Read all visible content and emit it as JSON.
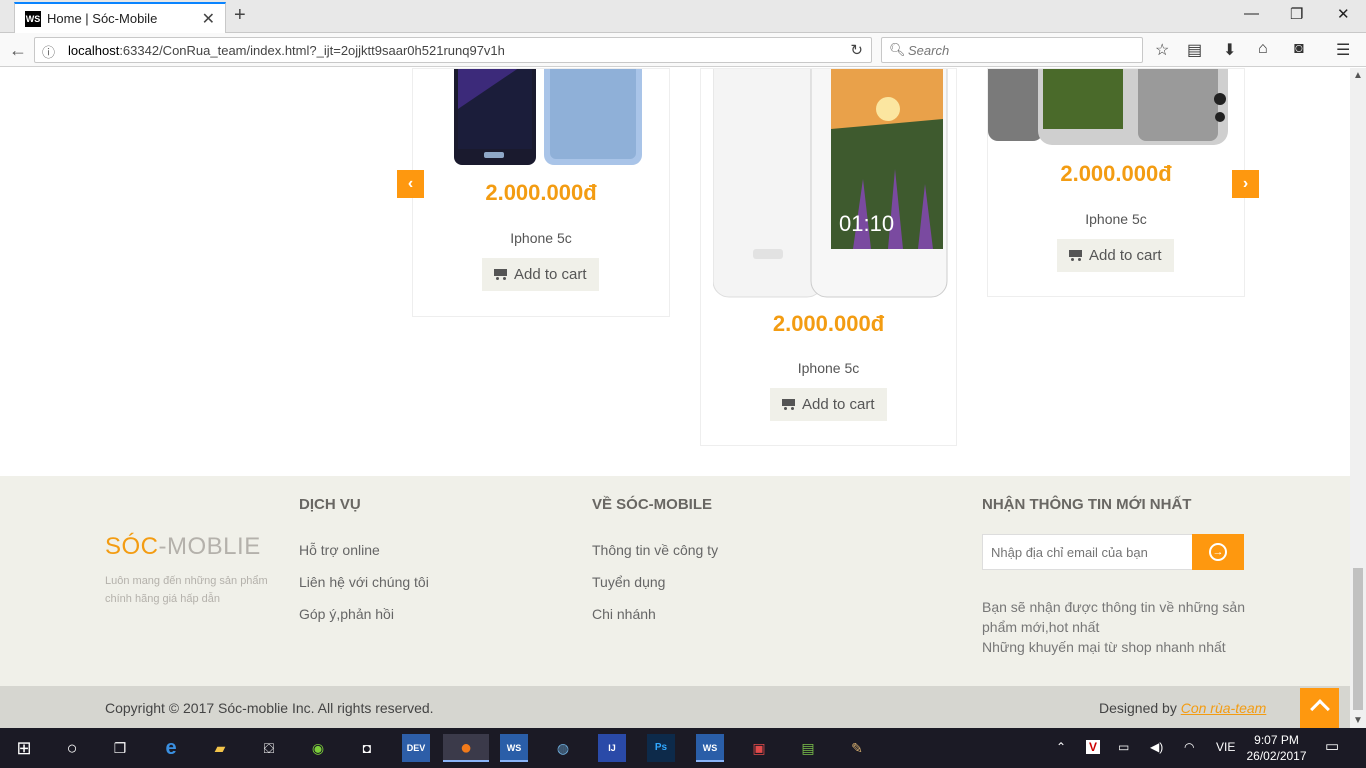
{
  "browser": {
    "tab_title": "Home | Sóc-Mobile",
    "tab_favicon": "WS",
    "url_host": "localhost",
    "url_rest": ":63342/ConRua_team/index.html?_ijt=2ojjktt9saar0h521runq97v1h",
    "search_placeholder": "Search"
  },
  "products": [
    {
      "price": "2.000.000đ",
      "name": "Iphone 5c",
      "cart_label": "Add to cart"
    },
    {
      "price": "2.000.000đ",
      "name": "Iphone 5c",
      "cart_label": "Add to cart"
    },
    {
      "price": "2.000.000đ",
      "name": "Iphone 5c",
      "cart_label": "Add to cart"
    }
  ],
  "carousel": {
    "prev_icon": "chevron-left-icon",
    "next_icon": "chevron-right-icon"
  },
  "footer": {
    "brand_main": "SÓC",
    "brand_rest": "-MOBLIE",
    "slogan": "Luôn mang đến những sản phẩm chính hãng giá hấp dẫn",
    "services": {
      "heading": "DỊCH VỤ",
      "links": [
        "Hỗ trợ online",
        "Liên hệ với chúng tôi",
        "Góp ý,phản hồi"
      ]
    },
    "about": {
      "heading": "VỀ SÓC-MOBILE",
      "links": [
        "Thông tin về công ty",
        "Tuyển dụng",
        "Chi nhánh"
      ]
    },
    "newsletter": {
      "heading": "NHẬN THÔNG TIN MỚI NHẤT",
      "placeholder": "Nhập địa chỉ email của bạn",
      "info_line1": "Bạn sẽ nhận được thông tin về những sản phẩm mới,hot nhất",
      "info_line2": "Những khuyến mại từ shop nhanh nhất"
    },
    "copyright": "Copyright © 2017 Sóc-moblie Inc. All rights reserved.",
    "designed_by": "Designed by ",
    "designer": "Con rùa-team"
  },
  "taskbar": {
    "lang": "VIE",
    "time": "9:07 PM",
    "date": "26/02/2017"
  },
  "colors": {
    "accent": "#fe980f",
    "price": "#f39c12",
    "footer_bg": "#f0f0e9"
  }
}
